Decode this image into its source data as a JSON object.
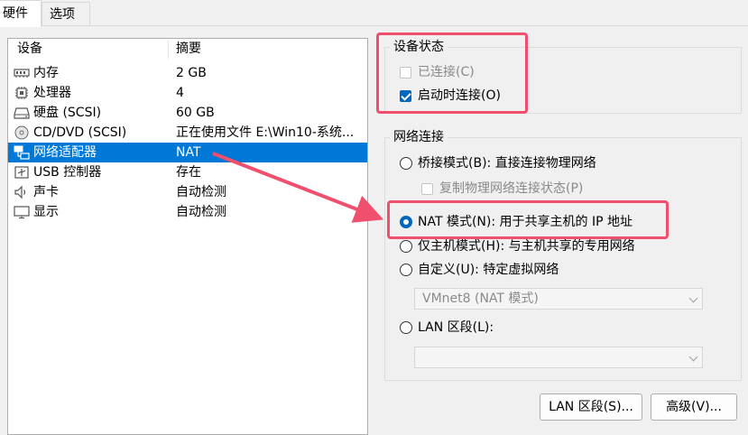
{
  "tabs": [
    {
      "label": "硬件",
      "active": true
    },
    {
      "label": "选项",
      "active": false
    }
  ],
  "device_list": {
    "columns": {
      "device": "设备",
      "summary": "摘要"
    },
    "rows": [
      {
        "device": "内存",
        "summary": "2 GB",
        "icon": "memory-icon"
      },
      {
        "device": "处理器",
        "summary": "4",
        "icon": "cpu-icon"
      },
      {
        "device": "硬盘 (SCSI)",
        "summary": "60 GB",
        "icon": "disk-icon"
      },
      {
        "device": "CD/DVD (SCSI)",
        "summary": "正在使用文件 E:\\Win10-系统...",
        "icon": "cd-icon"
      },
      {
        "device": "网络适配器",
        "summary": "NAT",
        "icon": "network-icon",
        "selected": true
      },
      {
        "device": "USB 控制器",
        "summary": "存在",
        "icon": "usb-icon"
      },
      {
        "device": "声卡",
        "summary": "自动检测",
        "icon": "speaker-icon"
      },
      {
        "device": "显示",
        "summary": "自动检测",
        "icon": "monitor-icon"
      }
    ]
  },
  "device_status": {
    "title": "设备状态",
    "connected": "已连接(C)",
    "connect_on_start": "启动时连接(O)"
  },
  "network": {
    "title": "网络连接",
    "bridged": "桥接模式(B): 直接连接物理网络",
    "replicate": "复制物理网络连接状态(P)",
    "nat": "NAT 模式(N): 用于共享主机的 IP 地址",
    "host_only": "仅主机模式(H): 与主机共享的专用网络",
    "custom": "自定义(U): 特定虚拟网络",
    "custom_value": "VMnet8 (NAT 模式)",
    "lan": "LAN 区段(L):",
    "lan_value": ""
  },
  "buttons": {
    "lan_segments": "LAN 区段(S)...",
    "advanced": "高级(V)..."
  },
  "colors": {
    "accent": "#0067c0",
    "selection": "#0078d7",
    "annotation": "#f0506e"
  }
}
